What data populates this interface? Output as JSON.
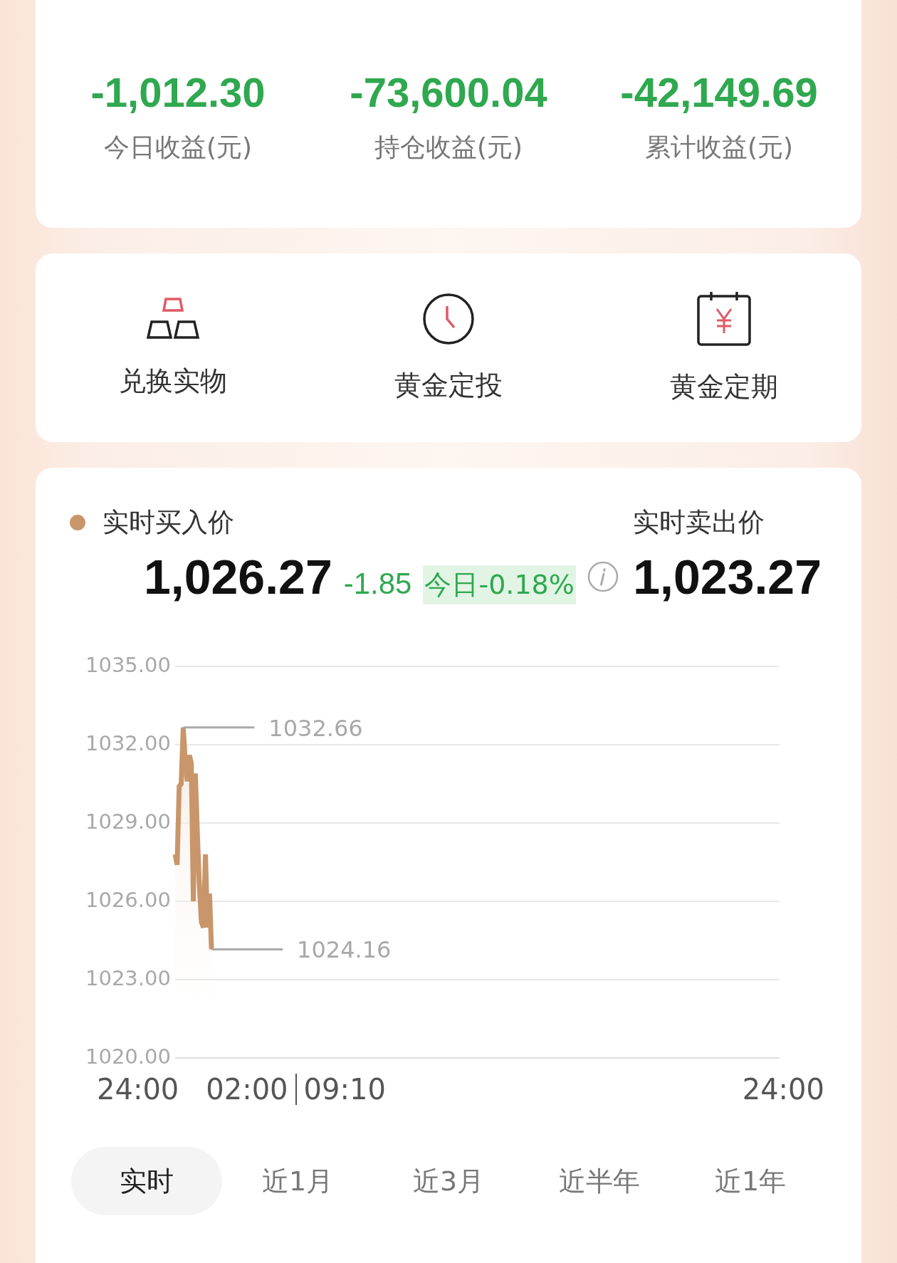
{
  "summary": [
    {
      "value": "-1,012.30",
      "label": "今日收益(元)"
    },
    {
      "value": "-73,600.04",
      "label": "持仓收益(元)"
    },
    {
      "value": "-42,149.69",
      "label": "累计收益(元)"
    }
  ],
  "shortcuts": [
    {
      "kind": "bars",
      "label": "兑换实物"
    },
    {
      "kind": "clock",
      "label": "黄金定投"
    },
    {
      "kind": "calendar",
      "label": "黄金定期"
    }
  ],
  "quote": {
    "buy_label": "实时买入价",
    "buy_price": "1,026.27",
    "change": "-1.85",
    "change_pct": "今日-0.18%",
    "sell_label": "实时卖出价",
    "sell_price": "1,023.27",
    "chart_data": {
      "type": "line",
      "grid": true,
      "categories": [
        null,
        null,
        null,
        null,
        null,
        null,
        null,
        null,
        null,
        null,
        null,
        null,
        null,
        null,
        null,
        null,
        null,
        null,
        null,
        null,
        null,
        null,
        null,
        null,
        null,
        null,
        null,
        null,
        null,
        null,
        null,
        null,
        null,
        null,
        null,
        null,
        null,
        null,
        null,
        null,
        null,
        null,
        null,
        null,
        null,
        null,
        null,
        null,
        null,
        null,
        null,
        null,
        null,
        null,
        null,
        null,
        null,
        null,
        null,
        null,
        null,
        null,
        null,
        null,
        null,
        null,
        null,
        null,
        null,
        null,
        null,
        null,
        null,
        null,
        null,
        null,
        null,
        null,
        null,
        null,
        null,
        null,
        null,
        null,
        null,
        null,
        null,
        null,
        null,
        null,
        null,
        null,
        null,
        null,
        null,
        null,
        null,
        null,
        null,
        null,
        null,
        null,
        null,
        null,
        null,
        null,
        null,
        null,
        null,
        null,
        null,
        null,
        null,
        null,
        null,
        null,
        null,
        null,
        null,
        null,
        null,
        null,
        null,
        null,
        null,
        null,
        null,
        null,
        null,
        null,
        null,
        null,
        null,
        null,
        null,
        null,
        null,
        null,
        null,
        null,
        null,
        null,
        null,
        null,
        null,
        null,
        null,
        null,
        null,
        null,
        null,
        null,
        null,
        null,
        null,
        null,
        null,
        null,
        null,
        null,
        null,
        null,
        null,
        null,
        null,
        null,
        null,
        null,
        null,
        null,
        null,
        null,
        null,
        null,
        null,
        null,
        null,
        null,
        null,
        null,
        null,
        null,
        null,
        null,
        null,
        null,
        null,
        null,
        null,
        null,
        null,
        null,
        null,
        null,
        null,
        null,
        null,
        null,
        null,
        null,
        null,
        null,
        null,
        null,
        null,
        null,
        null,
        null,
        null,
        null,
        null,
        null,
        null,
        null,
        null,
        null,
        null,
        null,
        null,
        null,
        null,
        null,
        null,
        null,
        null,
        null,
        null,
        null,
        null,
        null,
        null,
        null,
        null,
        null,
        null,
        null,
        null,
        null,
        null,
        null,
        null,
        null,
        null,
        null,
        null,
        null,
        null,
        null,
        null,
        null,
        null,
        null,
        null,
        null,
        null,
        null,
        null,
        null,
        null,
        null,
        null,
        null,
        null,
        null,
        null,
        null,
        null,
        null,
        null,
        null,
        null,
        null,
        null,
        null,
        null,
        null,
        null,
        null,
        null,
        null,
        null,
        null,
        null,
        null,
        null,
        null,
        null,
        null,
        null,
        null,
        null,
        null,
        null,
        null,
        null,
        null,
        null,
        null,
        null,
        null
      ],
      "ylim": [
        1020,
        1035
      ],
      "yticks": [
        {
          "value": 1035,
          "label": "1035.00"
        },
        {
          "value": 1032,
          "label": "1032.00"
        },
        {
          "value": 1029,
          "label": "1029.00"
        },
        {
          "value": 1026,
          "label": "1026.00"
        },
        {
          "value": 1023,
          "label": "1023.00"
        },
        {
          "value": 1020,
          "label": "1020.00"
        }
      ],
      "series": [
        {
          "color": "#c8966a",
          "values": [
            1027.8,
            1027.4,
            1030.4,
            1030.5,
            1032.66,
            1031.4,
            1030.6,
            1031.6,
            1031.3,
            1026.0,
            1030.9,
            1028.6,
            1026.6,
            1025.2,
            1025.0,
            1027.8,
            1025.0,
            1026.3,
            1024.16,
            null,
            null,
            null,
            null,
            null,
            null,
            null,
            null,
            null,
            null,
            null,
            null,
            null,
            null,
            null,
            null,
            null,
            null,
            null,
            null,
            null,
            null,
            null,
            null,
            null,
            null,
            null,
            null,
            null,
            null,
            null,
            null,
            null,
            null,
            null,
            null,
            null,
            null,
            null,
            null,
            null,
            null,
            null,
            null,
            null,
            null,
            null,
            null,
            null,
            null,
            null,
            null,
            null,
            null,
            null,
            null,
            null,
            null,
            null,
            null,
            null,
            null,
            null,
            null,
            null,
            null,
            null,
            null,
            null,
            null,
            null,
            null,
            null,
            null,
            null,
            null,
            null,
            null,
            null,
            null,
            null,
            null,
            null,
            null,
            null,
            null,
            null,
            null,
            null,
            null,
            null,
            null,
            null,
            null,
            null,
            null,
            null,
            null,
            null,
            null,
            null,
            null,
            null,
            null,
            null,
            null,
            null,
            null,
            null,
            null,
            null,
            null,
            null,
            null,
            null,
            null,
            null,
            null,
            null,
            null,
            null,
            null,
            null,
            null,
            null,
            null,
            null,
            null,
            null,
            null,
            null,
            null,
            null,
            null,
            null,
            null,
            null,
            null,
            null,
            null,
            null,
            null,
            null,
            null,
            null,
            null,
            null,
            null,
            null,
            null,
            null,
            null,
            null,
            null,
            null,
            null,
            null,
            null,
            null,
            null,
            null,
            null,
            null,
            null,
            null,
            null,
            null,
            null,
            null,
            null,
            null,
            null,
            null,
            null,
            null,
            null,
            null,
            null,
            null,
            null,
            null,
            null,
            null,
            null,
            null,
            null,
            null,
            null,
            null,
            null,
            null,
            null,
            null,
            null,
            null,
            null,
            null,
            null,
            null,
            null,
            null,
            null,
            null,
            null,
            null,
            null,
            null,
            null,
            null,
            null,
            null,
            null,
            null,
            null,
            null,
            null,
            null,
            null,
            null,
            null,
            null,
            null,
            null,
            null,
            null,
            null,
            null,
            null,
            null,
            null,
            null,
            null,
            null,
            null,
            null,
            null,
            null,
            null,
            null,
            null,
            null,
            null,
            null,
            null,
            null,
            null,
            null,
            null,
            null,
            null,
            null,
            null,
            null,
            null,
            null,
            null,
            null,
            null,
            null,
            null,
            null,
            null,
            null,
            null,
            null,
            null,
            null,
            null,
            null,
            null,
            null,
            null,
            null,
            null,
            null,
            null,
            null,
            null,
            null,
            null,
            null
          ]
        }
      ],
      "annotations": [
        {
          "text": "1032.66"
        },
        {
          "text": "1024.16"
        }
      ]
    },
    "time_labels": [
      "24:00",
      "02:00",
      "09:10",
      "24:00"
    ]
  },
  "periods": [
    {
      "label": "实时",
      "selected": true
    },
    {
      "label": "近1月",
      "selected": false
    },
    {
      "label": "近3月",
      "selected": false
    },
    {
      "label": "近半年",
      "selected": false
    },
    {
      "label": "近1年",
      "selected": false
    }
  ]
}
